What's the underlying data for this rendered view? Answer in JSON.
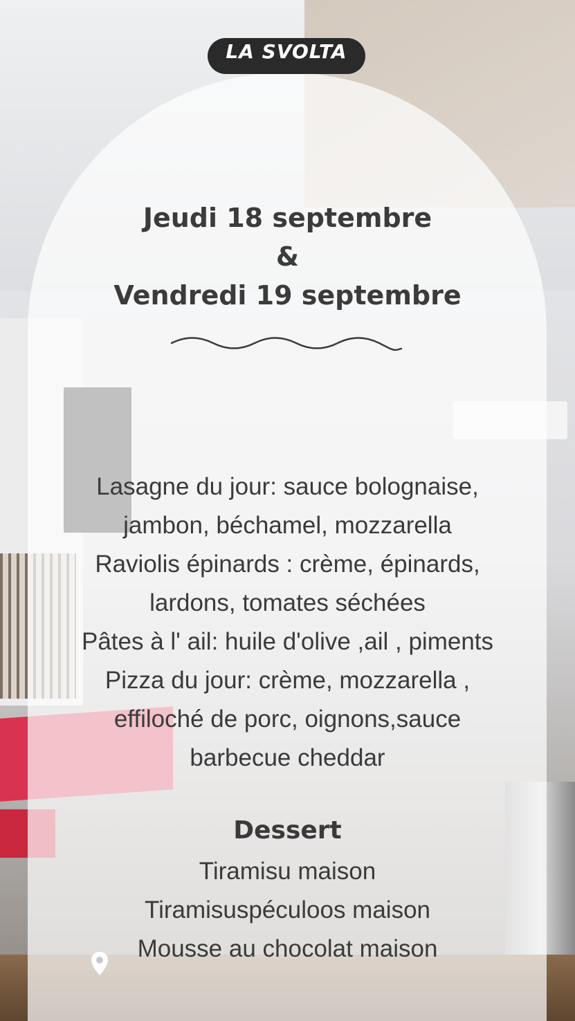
{
  "brand": {
    "name": "LA SVOLTA",
    "color": "#2a2a2a"
  },
  "dates": {
    "line1": "Jeudi 18 septembre",
    "connector": "&",
    "line2": "Vendredi 19 septembre"
  },
  "menu": {
    "lines": [
      "Lasagne du jour: sauce bolognaise,",
      "jambon, béchamel, mozzarella",
      "Raviolis épinards : crème, épinards,",
      "lardons, tomates séchées",
      "Pâtes à l' ail: huile d'olive ,ail , piments",
      "Pizza du jour: crème, mozzarella ,",
      "effiloché de porc, oignons,sauce",
      "barbecue  cheddar"
    ]
  },
  "dessert": {
    "title": "Dessert",
    "items": [
      "Tiramisu maison",
      "Tiramisuspéculoos maison",
      "Mousse au chocolat maison"
    ]
  },
  "icons": {
    "divider": "wavy-line-icon",
    "location": "location-pin-icon"
  }
}
